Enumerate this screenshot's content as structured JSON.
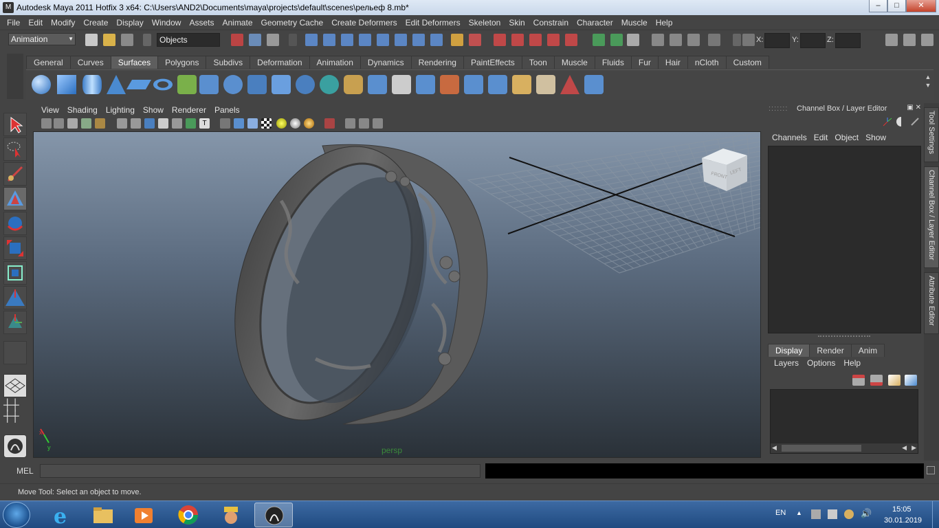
{
  "window": {
    "title": "Autodesk Maya 2011 Hotfix 3 x64: C:\\Users\\AND2\\Documents\\maya\\projects\\default\\scenes\\рельеф 8.mb*",
    "controls": [
      "–",
      "□",
      "✕"
    ]
  },
  "menubar": [
    "File",
    "Edit",
    "Modify",
    "Create",
    "Display",
    "Window",
    "Assets",
    "Animate",
    "Geometry Cache",
    "Create Deformers",
    "Edit Deformers",
    "Skeleton",
    "Skin",
    "Constrain",
    "Character",
    "Muscle",
    "Help"
  ],
  "statusline": {
    "mode": "Animation",
    "selection_mask": "Objects",
    "coords": {
      "x_label": "X:",
      "y_label": "Y:",
      "z_label": "Z:"
    }
  },
  "shelf": {
    "tabs": [
      "General",
      "Curves",
      "Surfaces",
      "Polygons",
      "Subdivs",
      "Deformation",
      "Animation",
      "Dynamics",
      "Rendering",
      "PaintEffects",
      "Toon",
      "Muscle",
      "Fluids",
      "Fur",
      "Hair",
      "nCloth",
      "Custom"
    ],
    "active_tab": "Surfaces"
  },
  "panel": {
    "menu": [
      "View",
      "Shading",
      "Lighting",
      "Show",
      "Renderer",
      "Panels"
    ],
    "camera_label": "persp",
    "viewcube": {
      "front": "FRONT",
      "left": "LEFT"
    }
  },
  "channel_box": {
    "title": "Channel Box / Layer Editor",
    "menu": [
      "Channels",
      "Edit",
      "Object",
      "Show"
    ]
  },
  "side_tabs": [
    "Tool Settings",
    "Channel Box / Layer Editor",
    "Attribute Editor"
  ],
  "layer_editor": {
    "tabs": [
      "Display",
      "Render",
      "Anim"
    ],
    "active_tab": "Display",
    "menu": [
      "Layers",
      "Options",
      "Help"
    ]
  },
  "command_line": {
    "label": "MEL"
  },
  "help_line": {
    "text": "Move Tool: Select an object to move."
  },
  "taskbar": {
    "language": "EN",
    "time": "15:05",
    "date": "30.01.2019"
  },
  "colors": {
    "ui_bg": "#444444",
    "viewport_top": "#8596aa",
    "viewport_bottom": "#2a3138",
    "model_gray": "#5a5a5a"
  }
}
